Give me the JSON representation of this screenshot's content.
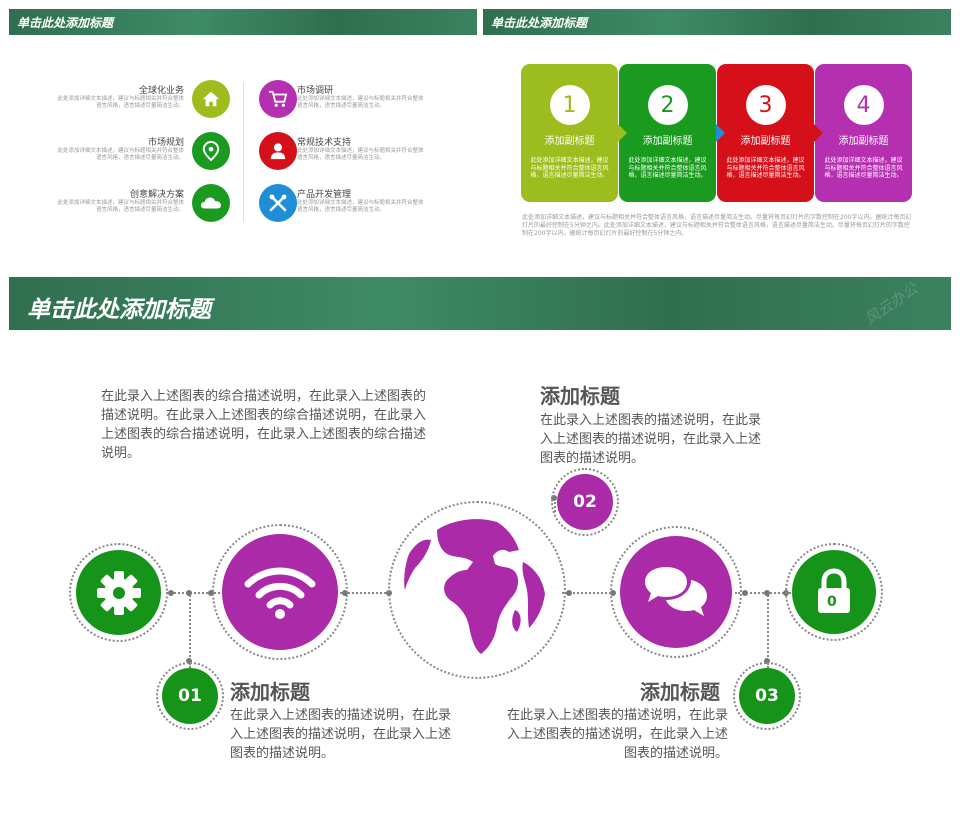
{
  "colors": {
    "lime": "#9dbd1e",
    "green": "#1a9a1e",
    "red": "#d51019",
    "purple": "#b530b0",
    "blue": "#1f8ed6",
    "main_purple": "#ab2aa8",
    "main_green": "#16941a"
  },
  "top_left": {
    "header": "单击此处添加标题",
    "items_left": [
      {
        "title": "全球化业务",
        "desc": "此处添加详细文本描述，建议与标题相关并符合整体语言风格，语言描述尽量简洁生动。",
        "icon": "home-icon",
        "color": "lime"
      },
      {
        "title": "市场规划",
        "desc": "此处添加详细文本描述，建议与标题相关并符合整体语言风格，语言描述尽量简洁生动。",
        "icon": "location-pin-icon",
        "color": "green"
      },
      {
        "title": "创意解决方案",
        "desc": "此处添加详细文本描述，建议与标题相关并符合整体语言风格，语言描述尽量简洁生动。",
        "icon": "cloud-icon",
        "color": "green"
      }
    ],
    "items_right": [
      {
        "title": "市场调研",
        "desc": "此处添加详细文本描述，建议与标题相关并符合整体语言风格，语言描述尽量简洁生动。",
        "icon": "cart-icon",
        "color": "purple"
      },
      {
        "title": "常规技术支持",
        "desc": "此处添加详细文本描述，建议与标题相关并符合整体语言风格，语言描述尽量简洁生动。",
        "icon": "user-icon",
        "color": "red"
      },
      {
        "title": "产品开发管理",
        "desc": "此处添加详细文本描述，建议与标题相关并符合整体语言风格，语言描述尽量简洁生动。",
        "icon": "tools-icon",
        "color": "blue"
      }
    ]
  },
  "top_right": {
    "header": "单击此处添加标题",
    "cards": [
      {
        "num": "1",
        "sub": "添加副标题",
        "desc": "此处添加详细文本描述，建议与标题相关并符合整体语言风格，语言描述尽量简洁生动。",
        "color": "lime"
      },
      {
        "num": "2",
        "sub": "添加副标题",
        "desc": "此处添加详细文本描述，建议与标题相关并符合整体语言风格，语言描述尽量简洁生动。",
        "color": "green"
      },
      {
        "num": "3",
        "sub": "添加副标题",
        "desc": "此处添加详细文本描述，建议与标题相关并符合整体语言风格，语言描述尽量简洁生动。",
        "color": "red"
      },
      {
        "num": "4",
        "sub": "添加副标题",
        "desc": "此处添加详细文本描述，建议与标题相关并符合整体语言风格，语言描述尽量简洁生动。",
        "color": "purple"
      }
    ],
    "footnote": "此处添加详细文本描述，建议与标题相关并符合整体语言风格，语言描述尽量简洁生动。尽量将每页幻灯片的字数控制在200字以内，据统计每页幻灯片的最好控制在5分钟之内。此处添加详细文本描述，建议与标题相关并符合整体语言风格，语言描述尽量简洁生动。尽量将每页幻灯片的字数控制在200字以内，据统计每页幻灯片的最好控制在5分钟之内。"
  },
  "main": {
    "header": "单击此处添加标题",
    "watermark": "风云办公",
    "top_para": "在此录入上述图表的综合描述说明，在此录入上述图表的描述说明。在此录入上述图表的综合描述说明，在此录入上述图表的综合描述说明，在此录入上述图表的综合描述说明。",
    "block02": {
      "badge": "02",
      "title": "添加标题",
      "desc": "在此录入上述图表的描述说明，在此录入上述图表的描述说明，在此录入上述图表的描述说明。"
    },
    "block01": {
      "badge": "01",
      "title": "添加标题",
      "desc": "在此录入上述图表的描述说明，在此录入上述图表的描述说明，在此录入上述图表的描述说明。"
    },
    "block03": {
      "badge": "03",
      "title": "添加标题",
      "desc": "在此录入上述图表的描述说明，在此录入上述图表的描述说明，在此录入上述图表的描述说明。"
    },
    "lock_label": "0"
  }
}
